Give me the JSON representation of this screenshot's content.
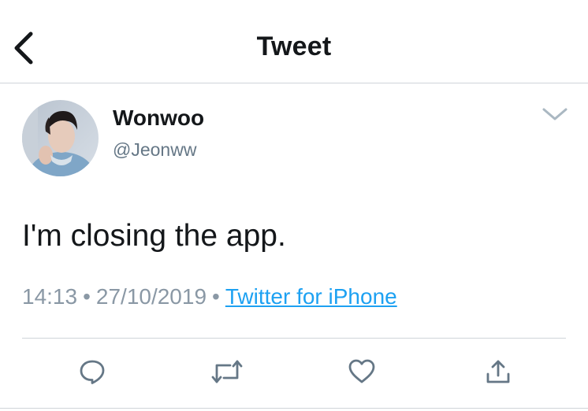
{
  "header": {
    "title": "Tweet",
    "back_icon": "chevron-left-icon"
  },
  "tweet": {
    "author": {
      "display_name": "Wonwoo",
      "handle": "@Jeonww"
    },
    "text": "I'm closing the app.",
    "time": "14:13",
    "date": "27/10/2019",
    "separator": "•",
    "source": "Twitter for iPhone",
    "more_icon": "chevron-down-icon"
  },
  "actions": [
    {
      "name": "reply",
      "icon": "reply-icon"
    },
    {
      "name": "retweet",
      "icon": "retweet-icon"
    },
    {
      "name": "like",
      "icon": "heart-icon"
    },
    {
      "name": "share",
      "icon": "share-icon"
    }
  ],
  "colors": {
    "text": "#14171a",
    "secondary": "#657786",
    "link": "#1da1f2",
    "icon": "#657786",
    "border": "#cfd4d9"
  }
}
